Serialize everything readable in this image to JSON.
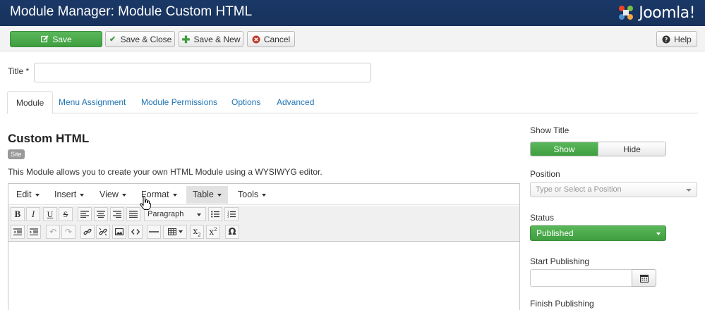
{
  "header": {
    "title": "Module Manager: Module Custom HTML",
    "brand": "Joomla!"
  },
  "toolbar": {
    "save": "Save",
    "save_close": "Save & Close",
    "save_new": "Save & New",
    "cancel": "Cancel",
    "help": "Help"
  },
  "form": {
    "title_label": "Title *",
    "title_value": ""
  },
  "tabs": [
    {
      "label": "Module"
    },
    {
      "label": "Menu Assignment"
    },
    {
      "label": "Module Permissions"
    },
    {
      "label": "Options"
    },
    {
      "label": "Advanced"
    }
  ],
  "module": {
    "heading": "Custom HTML",
    "badge": "Site",
    "description": "This Module allows you to create your own HTML Module using a WYSIWYG editor."
  },
  "editor": {
    "menu": [
      "Edit",
      "Insert",
      "View",
      "Format",
      "Table",
      "Tools"
    ],
    "format_select": "Paragraph"
  },
  "sidebar": {
    "show_title_label": "Show Title",
    "show": "Show",
    "hide": "Hide",
    "position_label": "Position",
    "position_placeholder": "Type or Select a Position",
    "status_label": "Status",
    "status_value": "Published",
    "start_publishing_label": "Start Publishing",
    "finish_publishing_label": "Finish Publishing"
  },
  "colors": {
    "header_bg": "#17325c",
    "success": "#46a546",
    "link": "#1f74b5"
  }
}
